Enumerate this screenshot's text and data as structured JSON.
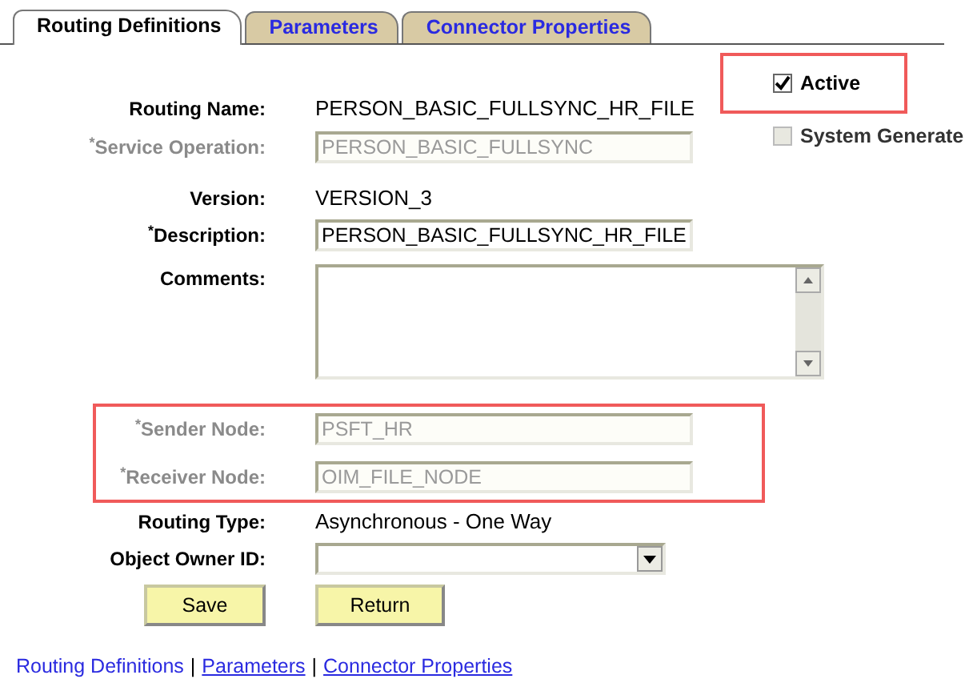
{
  "tabs": [
    {
      "label": "Routing Definitions",
      "selected": true
    },
    {
      "label": "Parameters",
      "selected": false
    },
    {
      "label": "Connector Properties",
      "selected": false
    }
  ],
  "checkboxes": [
    {
      "label": "Active",
      "checked": true,
      "disabled": false,
      "highlighted": true
    },
    {
      "label": "System Generate",
      "checked": false,
      "disabled": true
    }
  ],
  "fields": [
    {
      "kind": "text",
      "label": "Routing Name:",
      "value": "PERSON_BASIC_FULLSYNC_HR_FILE"
    },
    {
      "kind": "input",
      "label": "$^{*}$Service Operation:",
      "value": "PERSON_BASIC_FULLSYNC",
      "disabled": true
    },
    {
      "kind": "text",
      "label": "Version:",
      "value": "VERSION_3"
    },
    {
      "kind": "input",
      "label": "$^{*}$Description:",
      "value": "PERSON_BASIC_FULLSYNC_HR_FILE",
      "disabled": false
    },
    {
      "kind": "textarea",
      "label": "Comments:",
      "disabled": false
    }
  ],
  "nodes": {
    "highlighted": true,
    "fields": [
      {
        "kind": "input",
        "label": "$^{*}$Sender Node:",
        "value": "PSFT_HR",
        "disabled": true
      },
      {
        "kind": "input",
        "label": "$^{*}$Receiver Node:",
        "value": "OIM_FILE_NODE",
        "disabled": true
      }
    ]
  },
  "more_fields": [
    {
      "kind": "text",
      "label": "Routing Type:",
      "value": "Asynchronous - One Way"
    },
    {
      "kind": "select",
      "label": "Object Owner ID:",
      "disabled": false
    }
  ],
  "buttons": [
    "Save",
    "Return"
  ],
  "footer_links": [
    {
      "label": "Routing Definitions",
      "selected": true
    },
    {
      "label": "Parameters",
      "selected": false,
      "separator": "|"
    },
    {
      "label": "Connector Properties",
      "selected": false,
      "separator": "|"
    }
  ]
}
